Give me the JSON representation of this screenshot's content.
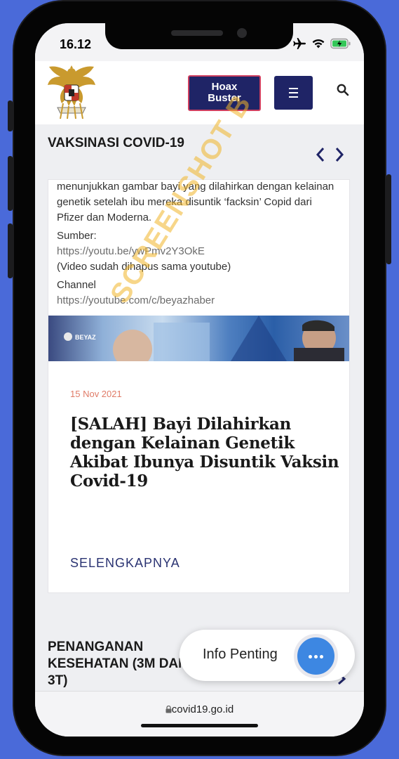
{
  "status_bar": {
    "time": "16.12"
  },
  "header": {
    "hoax_button_label": "Hoax\nBuster"
  },
  "section": {
    "title": "VAKSINASI COVID-19"
  },
  "article": {
    "excerpt": "menunjukkan gambar bayi yang dilahirkan dengan kelainan genetik setelah ibu mereka disuntik ‘facksin’ Copid dari Pfizer dan Moderna.",
    "source_label": "Sumber:",
    "source_url": "https://youtu.be/ywPmv2Y3OkE",
    "source_note": "(Video sudah dihapus sama youtube)",
    "channel_label": "Channel",
    "channel_url": "https://youtube.com/c/beyazhaber",
    "image_tag": "BEYAZ",
    "watermark": "SCREENSHOT B",
    "date": "15 Nov 2021",
    "title": "[SALAH] Bayi Dilahirkan dengan Kelainan Genetik Akibat Ibunya Disuntik Vaksin Covid-19",
    "more_label": "SELENGKAPNYA"
  },
  "section2": {
    "title": "PENANGANAN KESEHATAN (3M DAN 3T)"
  },
  "info_fab": {
    "label": "Info Penting"
  },
  "browser": {
    "url": "covid19.go.id"
  },
  "colors": {
    "navy": "#1f2466",
    "accent_red": "#d04060",
    "fab_blue": "#3d87e2",
    "date_orange": "#e07c68",
    "background": "#4a6ad9"
  }
}
